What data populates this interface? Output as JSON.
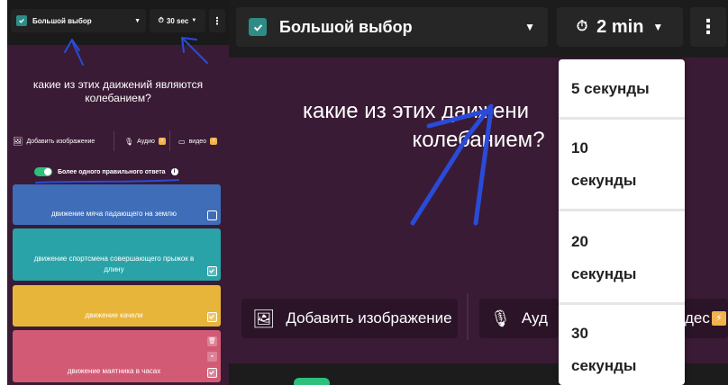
{
  "left": {
    "question_type": "Большой выбор",
    "timer": "30 sec",
    "more": "⋮",
    "question": "какие из этих даижений являются колебанием?",
    "media": {
      "image": "Добавить изображение",
      "audio": "Аудио",
      "video": "видео"
    },
    "multi_correct_label": "Более одного правильного ответа",
    "answers": [
      {
        "text": "движение мяча падающего на землю",
        "color": "#3f6db8",
        "checked": false
      },
      {
        "text": "движение спортсмена совершающего прыжок в длину",
        "color": "#2aa3a8",
        "checked": true
      },
      {
        "text": "движение качели",
        "color": "#e8b53b",
        "checked": true
      },
      {
        "text": "движение маятника в часах",
        "color": "#d25a74",
        "checked": true
      }
    ]
  },
  "right": {
    "question_type": "Большой выбор",
    "timer": "2 min",
    "more": "⋮",
    "question_line1": "какие из этих даижени",
    "question_line1_tail": "я",
    "question_line2": "колебанием",
    "question_line2_tail": "?",
    "media": {
      "image": "Добавить изображение",
      "audio": "Ауд",
      "video": "дес"
    },
    "timer_options": [
      [
        "5 секунды"
      ],
      [
        "10",
        "секунды"
      ],
      [
        "20",
        "секунды"
      ],
      [
        "30",
        "секунды"
      ]
    ]
  },
  "colors": {
    "accent_teal": "#2d8c86",
    "card_purple": "#3a1b35",
    "toggle_green": "#2cc07a",
    "badge_orange": "#f2b24c",
    "annotation_blue": "#2a4bd8"
  }
}
